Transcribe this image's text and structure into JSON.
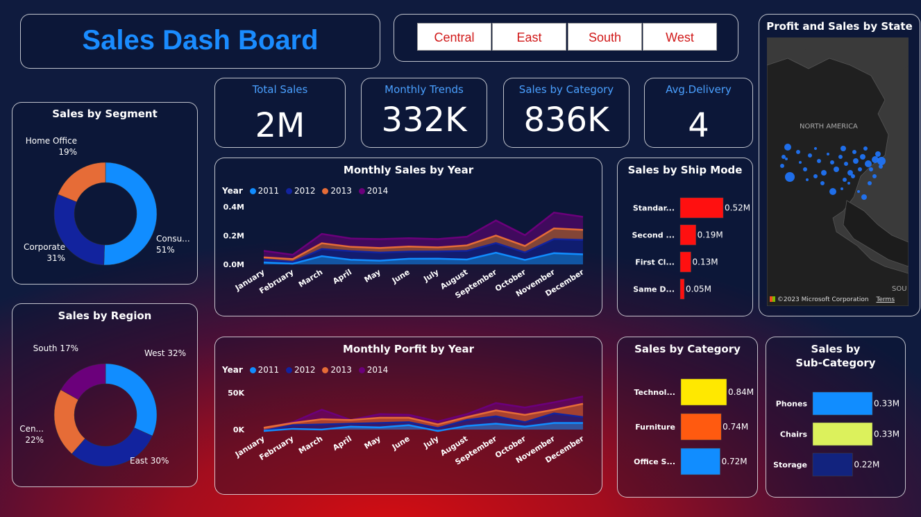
{
  "header": {
    "title": "Sales Dash Board"
  },
  "region_filter": {
    "buttons": [
      "Central",
      "East",
      "South",
      "West"
    ]
  },
  "kpis": [
    {
      "label": "Total Sales",
      "value": "2M"
    },
    {
      "label": "Monthly Trends",
      "value": "332K"
    },
    {
      "label": "Sales by Category",
      "value": "836K"
    },
    {
      "label": "Avg.Delivery",
      "value": "4"
    }
  ],
  "map": {
    "title": "Profit and Sales by State",
    "continent_label": "NORTH AMERICA",
    "edge_label": "SOU",
    "attribution": "©2023 Microsoft Corporation",
    "terms": "Terms",
    "logo_text": "Microsoft Bing"
  },
  "colors": {
    "c2011": "#118dff",
    "c2012": "#12239e",
    "c2013": "#e66c37",
    "c2014": "#6b007b"
  },
  "chart_data": [
    {
      "id": "segment",
      "type": "pie",
      "title": "Sales by Segment",
      "categories": [
        "Consumer",
        "Corporate",
        "Home Office"
      ],
      "display_labels": [
        "Consu...",
        "Corporate",
        "Home Office"
      ],
      "pct_labels": [
        "51%",
        "31%",
        "19%"
      ],
      "values": [
        51,
        31,
        19
      ],
      "colors": [
        "#118dff",
        "#12239e",
        "#e66c37"
      ]
    },
    {
      "id": "region",
      "type": "pie",
      "title": "Sales by Region",
      "categories": [
        "West",
        "East",
        "Central",
        "South"
      ],
      "display_labels": [
        "West 32%",
        "East 30%",
        "Cen...",
        "South 17%"
      ],
      "pct_labels": [
        "",
        "",
        "22%",
        ""
      ],
      "values": [
        32,
        30,
        22,
        17
      ],
      "colors": [
        "#118dff",
        "#12239e",
        "#e66c37",
        "#6b007b"
      ]
    },
    {
      "id": "monthly_sales",
      "type": "area",
      "title": "Monthly Sales by Year",
      "legend_title": "Year",
      "categories": [
        "January",
        "February",
        "March",
        "April",
        "May",
        "June",
        "July",
        "August",
        "September",
        "October",
        "November",
        "December"
      ],
      "y_ticks": [
        "0.0M",
        "0.2M",
        "0.4M"
      ],
      "ylim": [
        0,
        0.4
      ],
      "series": [
        {
          "name": "2011",
          "values": [
            0.014,
            0.005,
            0.057,
            0.032,
            0.026,
            0.039,
            0.04,
            0.034,
            0.081,
            0.031,
            0.078,
            0.07
          ]
        },
        {
          "name": "2012",
          "values": [
            0.02,
            0.012,
            0.05,
            0.06,
            0.056,
            0.05,
            0.05,
            0.06,
            0.067,
            0.052,
            0.098,
            0.1
          ]
        },
        {
          "name": "2013",
          "values": [
            0.015,
            0.02,
            0.04,
            0.03,
            0.032,
            0.035,
            0.028,
            0.038,
            0.052,
            0.045,
            0.074,
            0.07
          ]
        },
        {
          "name": "2014",
          "values": [
            0.045,
            0.03,
            0.065,
            0.058,
            0.062,
            0.058,
            0.058,
            0.06,
            0.105,
            0.075,
            0.11,
            0.09
          ]
        }
      ]
    },
    {
      "id": "monthly_profit",
      "type": "area",
      "title": "Monthly Porfit by Year",
      "legend_title": "Year",
      "categories": [
        "January",
        "February",
        "March",
        "April",
        "May",
        "June",
        "July",
        "August",
        "September",
        "October",
        "November",
        "December"
      ],
      "y_ticks": [
        "0K",
        "50K"
      ],
      "ylim": [
        0,
        50000
      ],
      "series": [
        {
          "name": "2011",
          "values": [
            -2000,
            1000,
            0,
            4000,
            3000,
            6000,
            -2000,
            5000,
            8000,
            4000,
            9000,
            9000
          ]
        },
        {
          "name": "2012",
          "values": [
            500,
            5000,
            7000,
            4000,
            6000,
            4000,
            4000,
            8000,
            10000,
            6000,
            13000,
            8000
          ]
        },
        {
          "name": "2013",
          "values": [
            4000,
            3000,
            7000,
            5000,
            7000,
            6000,
            5000,
            4000,
            8000,
            10000,
            5000,
            18000
          ]
        },
        {
          "name": "2014",
          "values": [
            -1000,
            1000,
            13000,
            0,
            5000,
            4000,
            4000,
            4000,
            10000,
            10000,
            10000,
            10000
          ]
        }
      ]
    },
    {
      "id": "ship_mode",
      "type": "bar",
      "title": "Sales by Ship Mode",
      "categories": [
        "Standar...",
        "Second ...",
        "First Cl...",
        "Same D..."
      ],
      "values": [
        0.52,
        0.19,
        0.13,
        0.05
      ],
      "value_labels": [
        "0.52M",
        "0.19M",
        "0.13M",
        "0.05M"
      ],
      "colors": [
        "#ff1010",
        "#ff1010",
        "#ff1010",
        "#ff1010"
      ]
    },
    {
      "id": "category",
      "type": "bar",
      "title": "Sales by Category",
      "categories": [
        "Technol...",
        "Furniture",
        "Office S..."
      ],
      "values": [
        0.84,
        0.74,
        0.72
      ],
      "value_labels": [
        "0.84M",
        "0.74M",
        "0.72M"
      ],
      "colors": [
        "#ffe800",
        "#ff5a10",
        "#118dff"
      ]
    },
    {
      "id": "subcategory",
      "type": "bar",
      "title": "Sales by",
      "title_line2": "Sub-Category",
      "categories": [
        "Phones",
        "Chairs",
        "Storage"
      ],
      "values": [
        0.33,
        0.33,
        0.22
      ],
      "value_labels": [
        "0.33M",
        "0.33M",
        "0.22M"
      ],
      "colors": [
        "#118dff",
        "#dcf15c",
        "#12237e"
      ]
    }
  ]
}
